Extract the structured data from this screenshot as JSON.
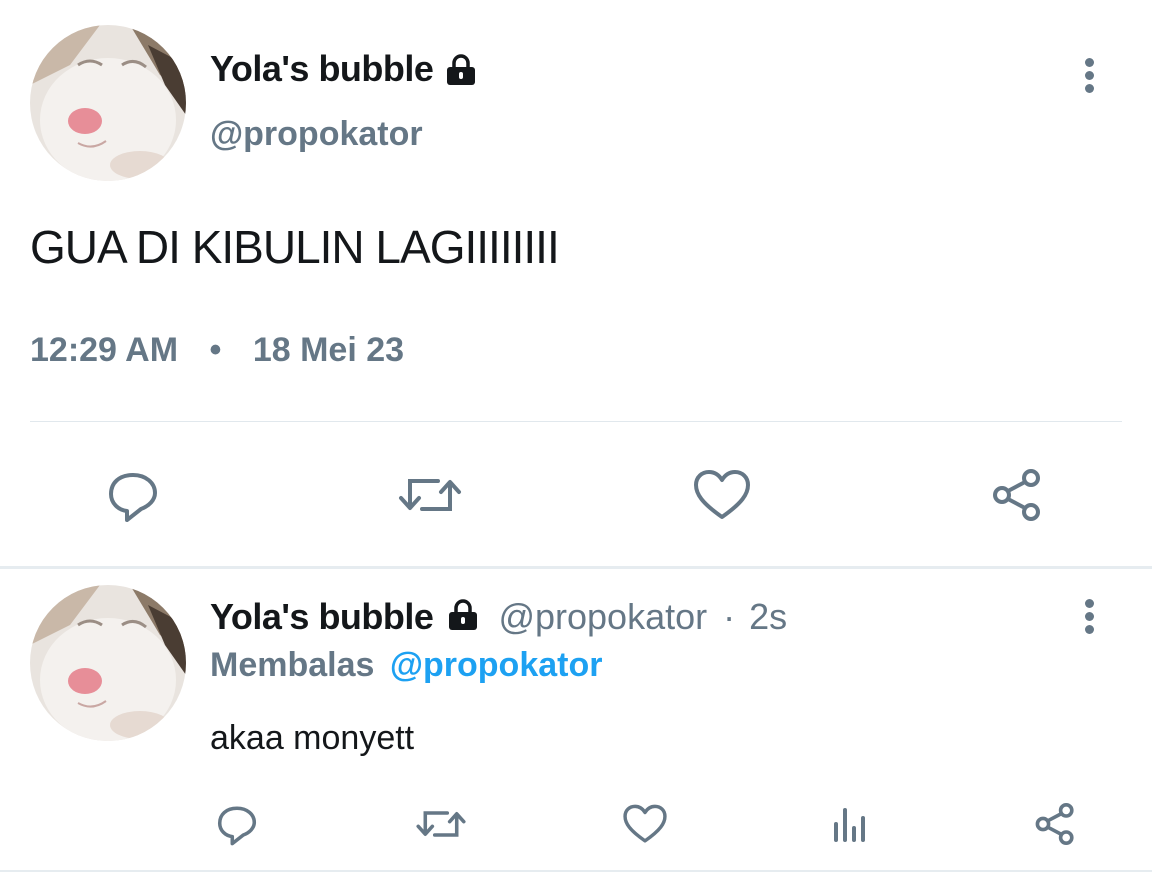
{
  "main_tweet": {
    "display_name": "Yola's bubble",
    "handle": "@propokator",
    "text": "GUA DI KIBULIN LAGIIIIIIII",
    "time": "12:29 AM",
    "separator": "•",
    "date": "18 Mei 23",
    "icons": {
      "lock": "lock-icon",
      "more": "more-vertical-icon",
      "reply": "reply-icon",
      "retweet": "retweet-icon",
      "like": "heart-icon",
      "share": "share-icon"
    }
  },
  "reply_tweet": {
    "display_name": "Yola's bubble",
    "handle": "@propokator",
    "dot": "·",
    "time_ago": "2s",
    "replying_prefix": "Membalas",
    "replying_to": "@propokator",
    "text": "akaa monyett",
    "icons": {
      "reply": "reply-icon",
      "retweet": "retweet-icon",
      "like": "heart-icon",
      "analytics": "analytics-icon",
      "share": "share-icon"
    }
  },
  "colors": {
    "text": "#14171a",
    "muted": "#657786",
    "accent": "#1da1f2",
    "divider": "#e1e8ed"
  }
}
